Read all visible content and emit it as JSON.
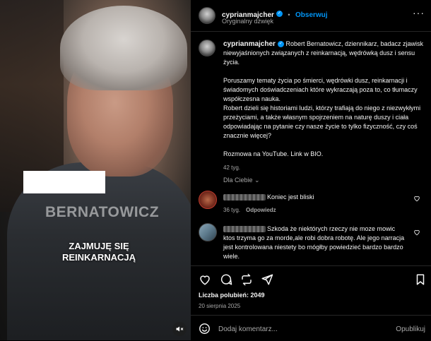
{
  "media": {
    "name_overlay": "BERNATOWICZ",
    "caption_line1": "ZAJMUJĘ SIĘ",
    "caption_line2": "REINKARNACJĄ",
    "mute_icon": "speaker-muted-icon"
  },
  "header": {
    "username": "cyprianmajcher",
    "separator": "•",
    "follow_label": "Obserwuj",
    "audio": "Oryginalny dźwięk",
    "more_label": "···"
  },
  "caption": {
    "username": "cyprianmajcher",
    "intro": "Robert Bernatowicz, dziennikarz, badacz zjawisk niewyjaśnionych związanych z reinkarnacją, wędrówką dusz i sensu życia.",
    "para1": "Poruszamy tematy życia po śmierci, wędrówki dusz, reinkarnacji i świadomych doświadczeniach które wykraczają poza to, co tłumaczy współczesna nauka.",
    "para2": "Robert dzieli się historiami ludzi, którzy trafiają do niego z niezwykłymi przeżyciami, a także własnym spojrzeniem na naturę duszy i ciała odpowiadając na pytanie czy nasze życie to tylko fizyczność, czy coś znacznie więcej?",
    "para3": "Rozmowa na YouTube. Link w BIO.",
    "time": "42 tyg."
  },
  "see_all": "Dla Ciebie ⌄",
  "comments": [
    {
      "text": "Koniec jest bliski",
      "time": "36 tyg.",
      "reply": "Odpowiedz"
    },
    {
      "text": "Szkoda że niektórych rzeczy nie moze mowic ktos trzyma go za morde,ale robi dobra robotę. Ale jego narracja jest kontrolowana niestety bo mógłby powiedzieć bardzo bardzo wiele."
    }
  ],
  "likes": "Liczba polubień: 2049",
  "date": "20 sierpnia 2025",
  "add_comment": {
    "placeholder": "Dodaj komentarz...",
    "post_label": "Opublikuj"
  },
  "colors": {
    "accent": "#0095f6",
    "background": "#000000",
    "muted": "#a8a8a8"
  }
}
